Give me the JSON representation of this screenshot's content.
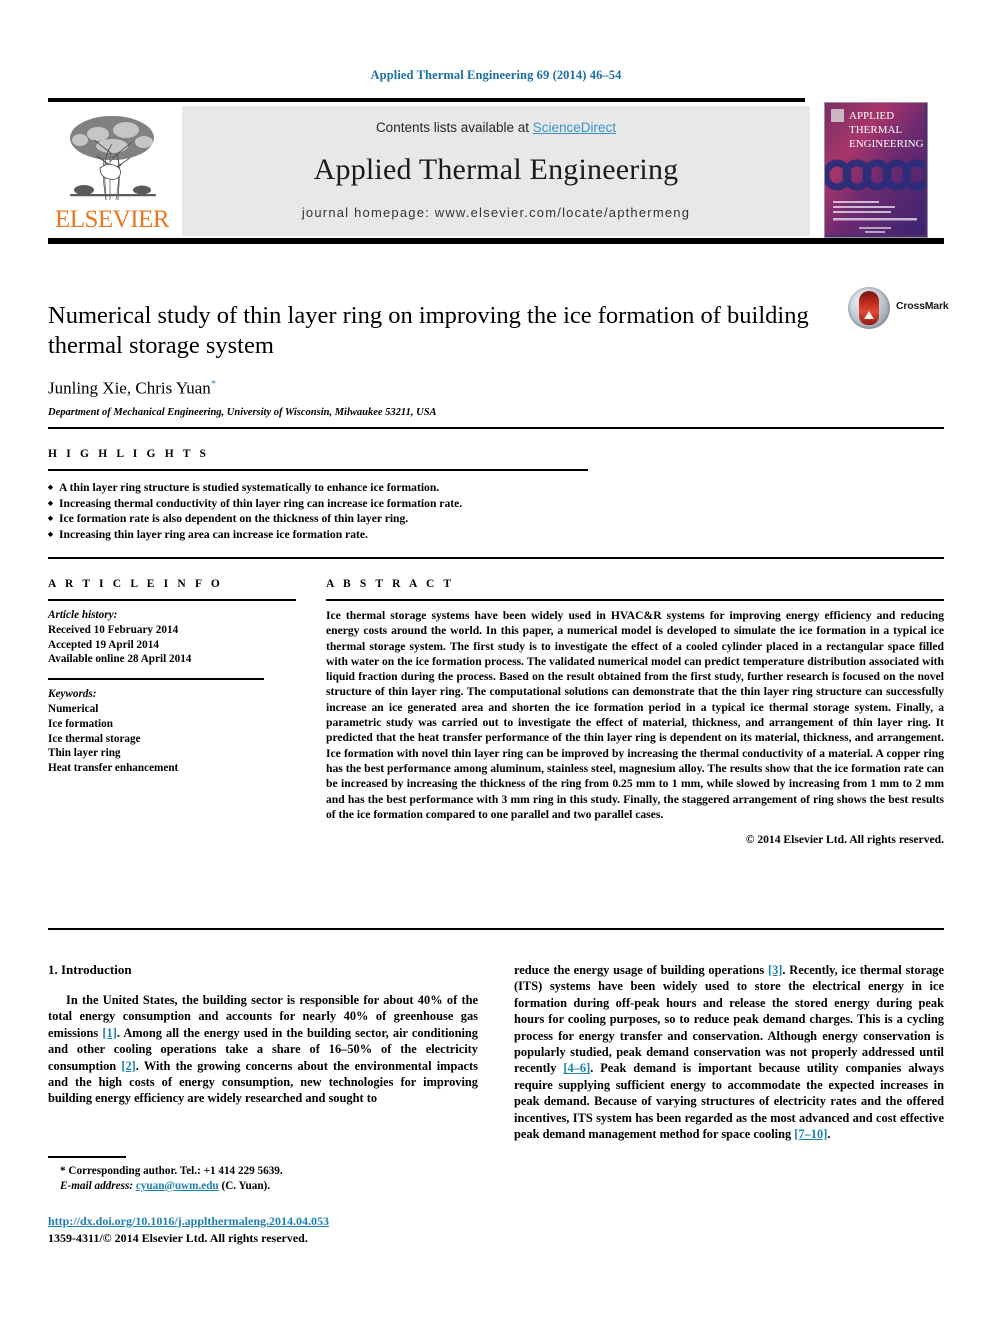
{
  "running_head": "Applied Thermal Engineering 69 (2014) 46–54",
  "masthead": {
    "contents_prefix": "Contents lists available at ",
    "sciencedirect": "ScienceDirect",
    "journal_title": "Applied Thermal Engineering",
    "homepage": "journal homepage: www.elsevier.com/locate/apthermeng",
    "publisher_logo_text": "ELSEVIER",
    "publisher_logo_color": "#E87722",
    "cover_title_lines": [
      "APPLIED",
      "THERMAL",
      "ENGINEERING"
    ]
  },
  "article": {
    "title": "Numerical study of thin layer ring on improving the ice formation of building thermal storage system",
    "authors": "Junling Xie, Chris Yuan",
    "author_marker": "*",
    "affiliation": "Department of Mechanical Engineering, University of Wisconsin, Milwaukee 53211, USA",
    "crossmark_label": "CrossMark"
  },
  "highlights": {
    "heading": "H I G H L I G H T S",
    "items": [
      "A thin layer ring structure is studied systematically to enhance ice formation.",
      "Increasing thermal conductivity of thin layer ring can increase ice formation rate.",
      "Ice formation rate is also dependent on the thickness of thin layer ring.",
      "Increasing thin layer ring area can increase ice formation rate."
    ]
  },
  "article_info": {
    "heading": "A R T I C L E   I N F O",
    "history_label": "Article history:",
    "history": [
      "Received 10 February 2014",
      "Accepted 19 April 2014",
      "Available online 28 April 2014"
    ],
    "keywords_label": "Keywords:",
    "keywords": [
      "Numerical",
      "Ice formation",
      "Ice thermal storage",
      "Thin layer ring",
      "Heat transfer enhancement"
    ]
  },
  "abstract": {
    "heading": "A B S T R A C T",
    "text": "Ice thermal storage systems have been widely used in HVAC&R systems for improving energy efficiency and reducing energy costs around the world. In this paper, a numerical model is developed to simulate the ice formation in a typical ice thermal storage system. The first study is to investigate the effect of a cooled cylinder placed in a rectangular space filled with water on the ice formation process. The validated numerical model can predict temperature distribution associated with liquid fraction during the process. Based on the result obtained from the first study, further research is focused on the novel structure of thin layer ring. The computational solutions can demonstrate that the thin layer ring structure can successfully increase an ice generated area and shorten the ice formation period in a typical ice thermal storage system. Finally, a parametric study was carried out to investigate the effect of material, thickness, and arrangement of thin layer ring. It predicted that the heat transfer performance of the thin layer ring is dependent on its material, thickness, and arrangement. Ice formation with novel thin layer ring can be improved by increasing the thermal conductivity of a material. A copper ring has the best performance among aluminum, stainless steel, magnesium alloy. The results show that the ice formation rate can be increased by increasing the thickness of the ring from 0.25 mm to 1 mm, while slowed by increasing from 1 mm to 2 mm and has the best performance with 3 mm ring in this study. Finally, the staggered arrangement of ring shows the best results of the ice formation compared to one parallel and two parallel cases.",
    "copyright": "© 2014 Elsevier Ltd. All rights reserved."
  },
  "introduction": {
    "section_title": "1. Introduction",
    "left_paragraph_parts": [
      "In the United States, the building sector is responsible for about 40% of the total energy consumption and accounts for nearly 40% of greenhouse gas emissions ",
      "[1]",
      ". Among all the energy used in the building sector, air conditioning and other cooling operations take a share of 16–50% of the electricity consumption ",
      "[2]",
      ". With the growing concerns about the environmental impacts and the high costs of energy consumption, new technologies for improving building energy efficiency are widely researched and sought to"
    ],
    "right_paragraph_parts": [
      "reduce the energy usage of building operations ",
      "[3]",
      ". Recently, ice thermal storage (ITS) systems have been widely used to store the electrical energy in ice formation during off-peak hours and release the stored energy during peak hours for cooling purposes, so to reduce peak demand charges. This is a cycling process for energy transfer and conservation. Although energy conservation is popularly studied, peak demand conservation was not properly addressed until recently ",
      "[4–6]",
      ". Peak demand is important because utility companies always require supplying sufficient energy to accommodate the expected increases in peak demand. Because of varying structures of electricity rates and the offered incentives, ITS system has been regarded as the most advanced and cost effective peak demand management method for space cooling ",
      "[7–10]",
      "."
    ]
  },
  "footnote": {
    "corresponding": "* Corresponding author. Tel.: +1 414 229 5639.",
    "email_label": "E-mail address:",
    "email": "cyuan@uwm.edu",
    "email_suffix": "(C. Yuan)."
  },
  "footer": {
    "doi": "http://dx.doi.org/10.1016/j.applthermaleng.2014.04.053",
    "issn_line": "1359-4311/© 2014 Elsevier Ltd. All rights reserved."
  },
  "colors": {
    "link": "#1c7fb4",
    "running_head": "#1c6ea4",
    "elsevier_orange": "#E87722",
    "sciencedirect": "#3a94c8"
  }
}
